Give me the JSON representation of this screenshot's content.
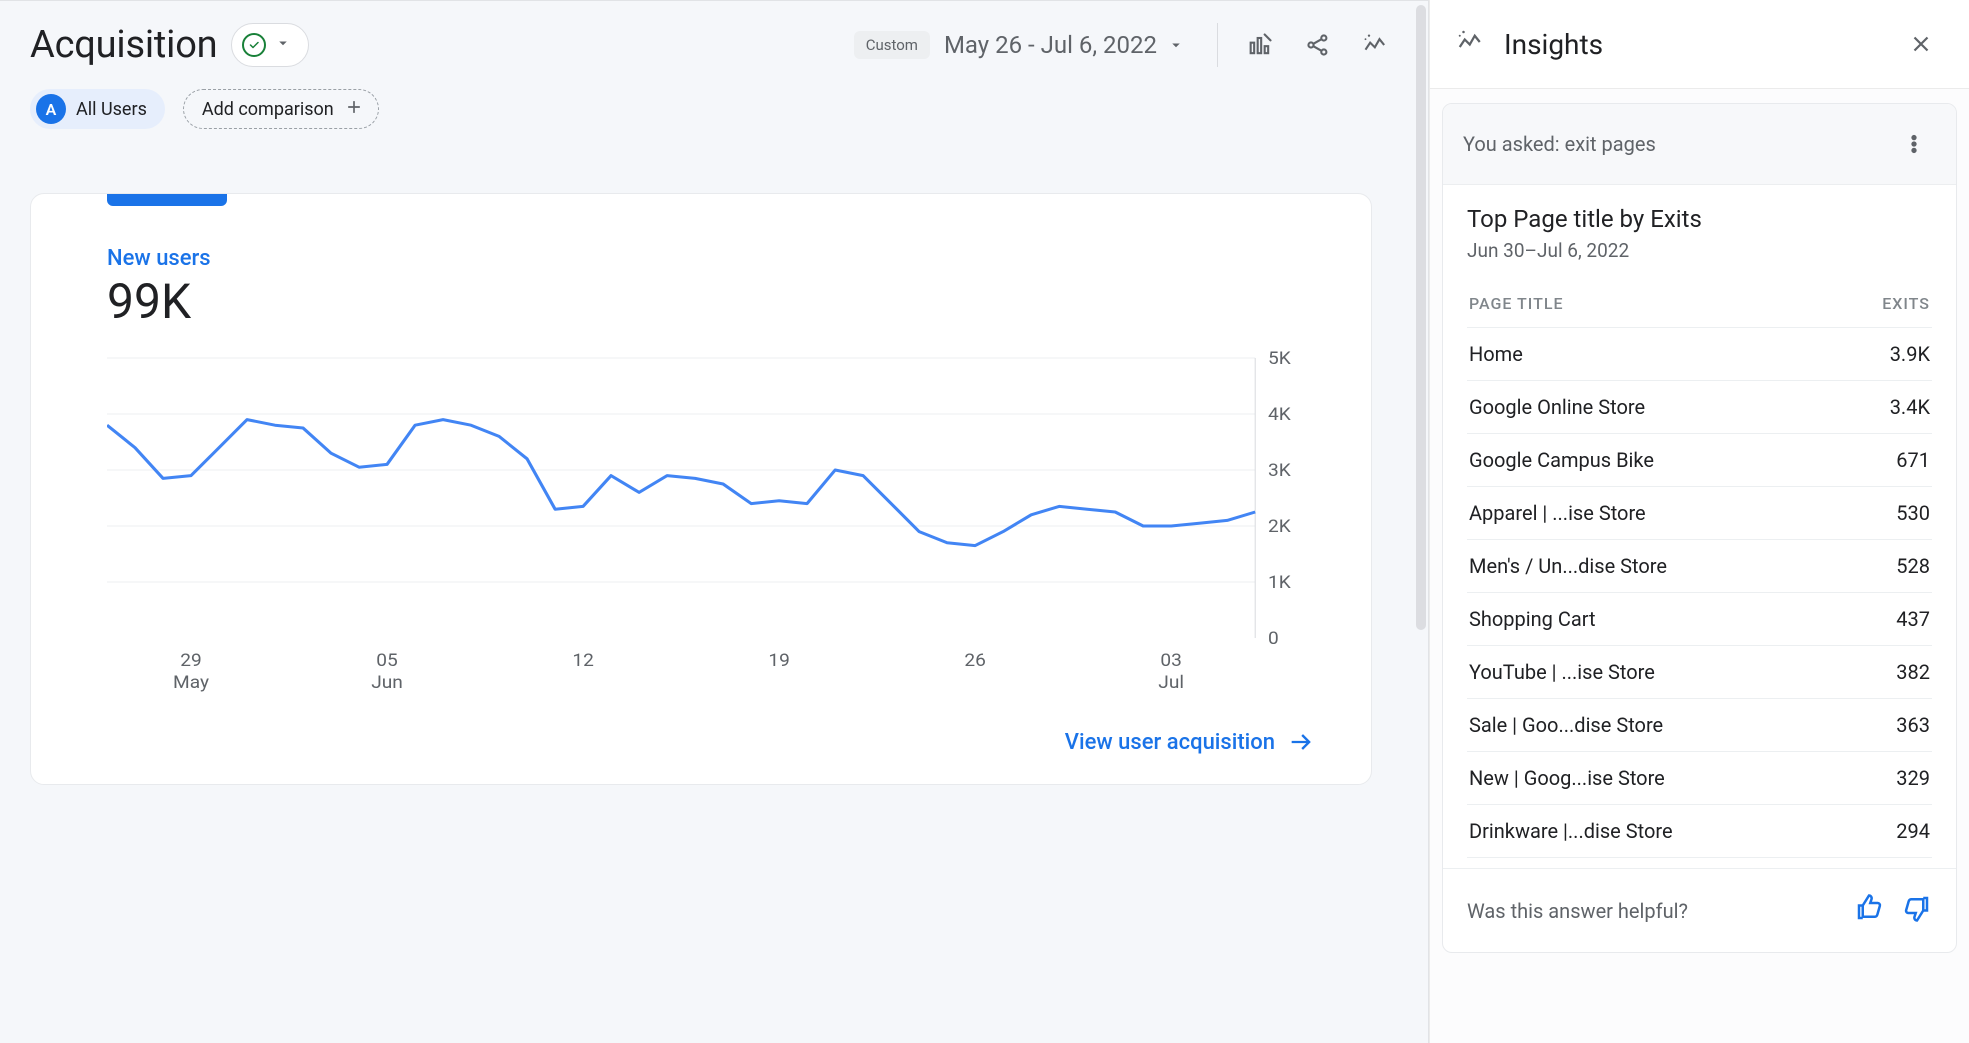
{
  "header": {
    "title": "Acquisition",
    "status": "ok",
    "date_label_prefix": "Custom",
    "date_range": "May 26 - Jul 6, 2022"
  },
  "filters": {
    "audience_badge": "A",
    "audience_label": "All Users",
    "add_comparison_label": "Add comparison"
  },
  "card": {
    "metric_label": "New users",
    "metric_value": "99K",
    "view_link": "View user acquisition"
  },
  "chart_data": {
    "type": "line",
    "title": "",
    "xlabel": "",
    "ylabel": "",
    "ylim": [
      0,
      5000
    ],
    "y_ticks": [
      0,
      1000,
      2000,
      3000,
      4000,
      5000
    ],
    "y_tick_labels": [
      "0",
      "1K",
      "2K",
      "3K",
      "4K",
      "5K"
    ],
    "x_major_ticks": [
      "29\nMay",
      "05\nJun",
      "12",
      "19",
      "26",
      "03\nJul"
    ],
    "series": [
      {
        "name": "New users",
        "x": [
          "2022-05-26",
          "2022-05-27",
          "2022-05-28",
          "2022-05-29",
          "2022-05-30",
          "2022-05-31",
          "2022-06-01",
          "2022-06-02",
          "2022-06-03",
          "2022-06-04",
          "2022-06-05",
          "2022-06-06",
          "2022-06-07",
          "2022-06-08",
          "2022-06-09",
          "2022-06-10",
          "2022-06-11",
          "2022-06-12",
          "2022-06-13",
          "2022-06-14",
          "2022-06-15",
          "2022-06-16",
          "2022-06-17",
          "2022-06-18",
          "2022-06-19",
          "2022-06-20",
          "2022-06-21",
          "2022-06-22",
          "2022-06-23",
          "2022-06-24",
          "2022-06-25",
          "2022-06-26",
          "2022-06-27",
          "2022-06-28",
          "2022-06-29",
          "2022-06-30",
          "2022-07-01",
          "2022-07-02",
          "2022-07-03",
          "2022-07-04",
          "2022-07-05",
          "2022-07-06"
        ],
        "values": [
          3800,
          3400,
          2850,
          2900,
          3400,
          3900,
          3800,
          3750,
          3300,
          3050,
          3100,
          3800,
          3900,
          3800,
          3600,
          3200,
          2300,
          2350,
          2900,
          2600,
          2900,
          2850,
          2750,
          2400,
          2450,
          2400,
          3000,
          2900,
          2400,
          1900,
          1700,
          1650,
          1900,
          2200,
          2350,
          2300,
          2250,
          2000,
          2000,
          2050,
          2100,
          2250
        ]
      }
    ]
  },
  "insights": {
    "panel_title": "Insights",
    "asked_prefix": "You asked: ",
    "asked_query": "exit pages",
    "card_title": "Top Page title by Exits",
    "card_range": "Jun 30–Jul 6, 2022",
    "col_page": "PAGE TITLE",
    "col_exits": "EXITS",
    "rows": [
      {
        "page": "Home",
        "exits": "3.9K"
      },
      {
        "page": "Google Online Store",
        "exits": "3.4K"
      },
      {
        "page": "Google Campus Bike",
        "exits": "671"
      },
      {
        "page": "Apparel | ...ise Store",
        "exits": "530"
      },
      {
        "page": "Men's / Un...dise Store",
        "exits": "528"
      },
      {
        "page": "Shopping Cart",
        "exits": "437"
      },
      {
        "page": "YouTube | ...ise Store",
        "exits": "382"
      },
      {
        "page": "Sale | Goo...dise Store",
        "exits": "363"
      },
      {
        "page": "New | Goog...ise Store",
        "exits": "329"
      },
      {
        "page": "Drinkware |...dise Store",
        "exits": "294"
      }
    ],
    "helpful_label": "Was this answer helpful?"
  },
  "colors": {
    "blue": "#1a73e8",
    "line": "#4285f4",
    "green": "#188038"
  }
}
